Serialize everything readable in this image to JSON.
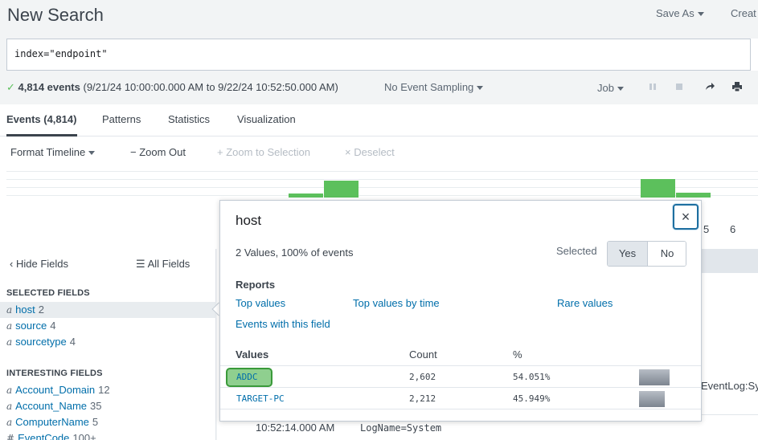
{
  "header": {
    "title": "New Search",
    "save_as": "Save As",
    "create": "Creat"
  },
  "search": {
    "query": "index=\"endpoint\""
  },
  "status": {
    "count": "4,814 events",
    "range": "(9/21/24 10:00:00.000 AM to 9/22/24 10:52:50.000 AM)",
    "sampling": "No Event Sampling",
    "job": "Job"
  },
  "tabs": {
    "events": "Events (4,814)",
    "patterns": "Patterns",
    "statistics": "Statistics",
    "visualization": "Visualization"
  },
  "timeline": {
    "format": "Format Timeline",
    "zoom_out": "Zoom Out",
    "zoom_to_selection": "Zoom to Selection",
    "deselect": "Deselect",
    "tick_5": "5",
    "tick_6": "6"
  },
  "sidebar": {
    "hide_fields": "Hide Fields",
    "all_fields": "All Fields",
    "selected_heading": "SELECTED FIELDS",
    "interesting_heading": "INTERESTING FIELDS",
    "type_marker": "a",
    "selected": [
      {
        "name": "host",
        "count": "2"
      },
      {
        "name": "source",
        "count": "4"
      },
      {
        "name": "sourcetype",
        "count": "4"
      }
    ],
    "interesting": [
      {
        "name": "Account_Domain",
        "count": "12"
      },
      {
        "name": "Account_Name",
        "count": "35"
      },
      {
        "name": "ComputerName",
        "count": "5"
      },
      {
        "name": "EventCode",
        "count": "100+"
      }
    ],
    "hash_marker": "#"
  },
  "events": {
    "time": "10:52:14.000 AM",
    "log": "LogName=System",
    "eventlog": "EventLog:Sy"
  },
  "popover": {
    "title": "host",
    "summary": "2 Values, 100% of events",
    "selected_label": "Selected",
    "yes": "Yes",
    "no": "No",
    "reports_label": "Reports",
    "top_values": "Top values",
    "top_values_by_time": "Top values by time",
    "rare_values": "Rare values",
    "events_with_field": "Events with this field",
    "col_values": "Values",
    "col_count": "Count",
    "col_pct": "%",
    "rows": [
      {
        "value": "ADDC",
        "count": "2,602",
        "pct": "54.051%",
        "fraction": 0.54051
      },
      {
        "value": "TARGET-PC",
        "count": "2,212",
        "pct": "45.949%",
        "fraction": 0.45949
      }
    ],
    "close": "×"
  }
}
